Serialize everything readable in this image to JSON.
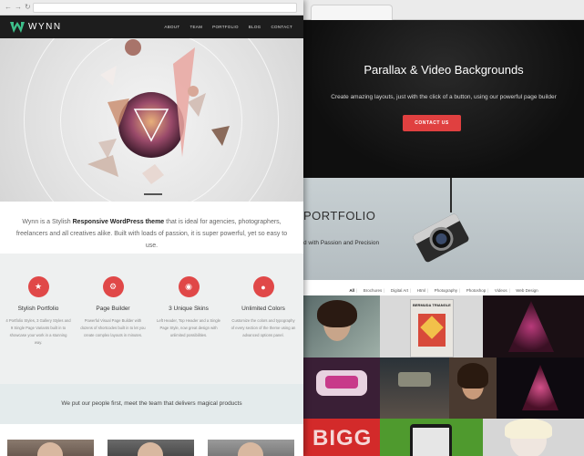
{
  "front": {
    "logo_text": "WYNN",
    "nav": [
      "ABOUT",
      "TEAM",
      "PORTFOLIO",
      "BLOG",
      "CONTACT"
    ],
    "intro_prefix": "Wynn is a Stylish ",
    "intro_bold": "Responsive WordPress theme",
    "intro_suffix": " that is ideal for agencies, photographers, freelancers and all creatives alike. Built with loads of passion, it is super powerful, yet so easy to use.",
    "features": [
      {
        "title": "Stylish Portfolio",
        "icon": "star-icon",
        "desc": "4 Portfolio Styles, 3 Gallery Styles and 9 Single Page Variants built in to showcase your work in a stunning way."
      },
      {
        "title": "Page Builder",
        "icon": "gear-icon",
        "desc": "Powerful Visual Page Builder with dozens of shortcodes built in to let you create complex layouts in minutes."
      },
      {
        "title": "3 Unique Skins",
        "icon": "eye-icon",
        "desc": "Left Header, Top Header and a Single Page Style, now great design with unlimited possibilities."
      },
      {
        "title": "Unlimited Colors",
        "icon": "drop-icon",
        "desc": "Customize the colors and typography of every section of the theme using an advanced options panel."
      }
    ],
    "team_text": "We put our people first, meet the team that delivers magical products"
  },
  "back": {
    "hero_title": "Parallax & Video Backgrounds",
    "hero_sub": "Create amazing layouts, just with the click of a button, using our powerful page builder",
    "hero_button": "CONTACT US",
    "portfolio_title": "PORTFOLIO",
    "portfolio_sub": "d with Passion and Precision",
    "filters": [
      "All",
      "Brochures",
      "Digital Art",
      "Html",
      "Photography",
      "Photoshop",
      "Videos",
      "Web Design"
    ],
    "tile_labels": [
      "BERMUDA TRIANGLE",
      "BIGG"
    ]
  },
  "colors": {
    "accent": "#e04848",
    "header_bg": "#1d1d1d",
    "logo_green": "#3dbf8a"
  }
}
